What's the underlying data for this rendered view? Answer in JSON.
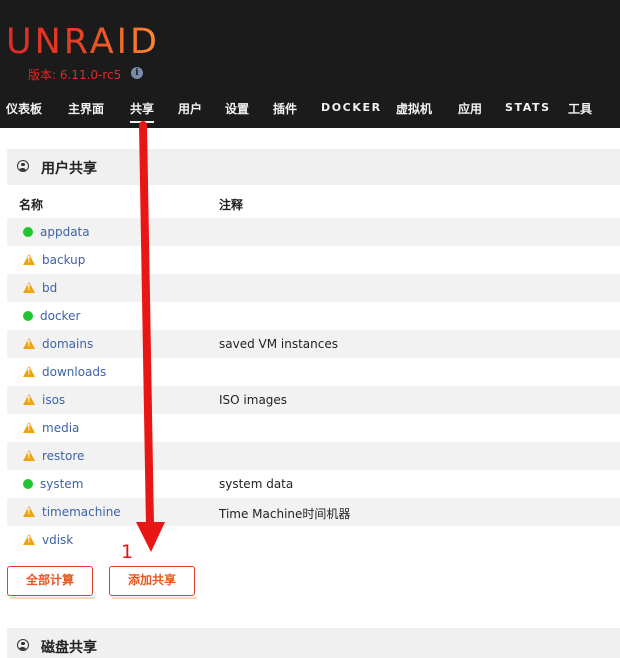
{
  "header": {
    "logo": "UNRAID",
    "version": "版本: 6.11.0-rc5",
    "info_icon": "info-icon"
  },
  "nav": {
    "items": [
      {
        "label": "仪表板"
      },
      {
        "label": "主界面"
      },
      {
        "label": "共享",
        "active": true
      },
      {
        "label": "用户"
      },
      {
        "label": "设置"
      },
      {
        "label": "插件"
      },
      {
        "label": "DOCKER"
      },
      {
        "label": "虚拟机"
      },
      {
        "label": "应用"
      },
      {
        "label": "STATS"
      },
      {
        "label": "工具"
      }
    ]
  },
  "user_shares": {
    "title": "用户共享",
    "icon": "user-circle-icon",
    "columns": {
      "name": "名称",
      "comment": "注释"
    },
    "rows": [
      {
        "status": "green",
        "name": "appdata",
        "comment": ""
      },
      {
        "status": "warning",
        "name": "backup",
        "comment": ""
      },
      {
        "status": "warning",
        "name": "bd",
        "comment": ""
      },
      {
        "status": "green",
        "name": "docker",
        "comment": ""
      },
      {
        "status": "warning",
        "name": "domains",
        "comment": "saved VM instances"
      },
      {
        "status": "warning",
        "name": "downloads",
        "comment": ""
      },
      {
        "status": "warning",
        "name": "isos",
        "comment": "ISO images"
      },
      {
        "status": "warning",
        "name": "media",
        "comment": ""
      },
      {
        "status": "warning",
        "name": "restore",
        "comment": ""
      },
      {
        "status": "green",
        "name": "system",
        "comment": "system data"
      },
      {
        "status": "warning",
        "name": "timemachine",
        "comment": "Time Machine时间机器"
      },
      {
        "status": "warning",
        "name": "vdisk",
        "comment": ""
      }
    ],
    "buttons": {
      "compute_all": "全部计算",
      "add_share": "添加共享"
    }
  },
  "disk_shares": {
    "title": "磁盘共享",
    "icon": "user-circle-icon"
  },
  "annotation": {
    "number": "1",
    "color": "#e11414"
  },
  "colors": {
    "header_bg": "#1c1b1b",
    "logo_red": "#e22828",
    "logo_orange": "#ff8c2f",
    "link_blue": "#3e63a6",
    "status_green": "#1fc531",
    "status_warning": "#f0a30a",
    "button_border": "#e53b2b"
  }
}
